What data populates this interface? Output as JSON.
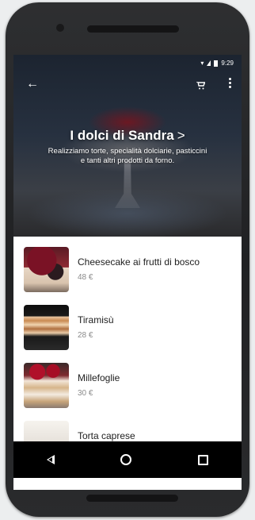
{
  "status_bar": {
    "time": "9:29"
  },
  "header": {
    "title": "I dolci di Sandra",
    "title_chevron": ">",
    "subtitle": "Realizziamo torte, specialità dolciarie, pasticcini e tanti altri prodotti da forno."
  },
  "icons": {
    "back": "arrow-left-icon",
    "cart": "shopping-cart-icon",
    "more": "more-vert-icon"
  },
  "products": [
    {
      "name": "Cheesecake ai frutti di bosco",
      "price": "48 €"
    },
    {
      "name": "Tiramisù",
      "price": "28 €"
    },
    {
      "name": "Millefoglie",
      "price": "30 €"
    },
    {
      "name": "Torta caprese",
      "price": ""
    }
  ],
  "colors": {
    "hero_dark": "#1c2430",
    "nav_bar": "#000000"
  }
}
